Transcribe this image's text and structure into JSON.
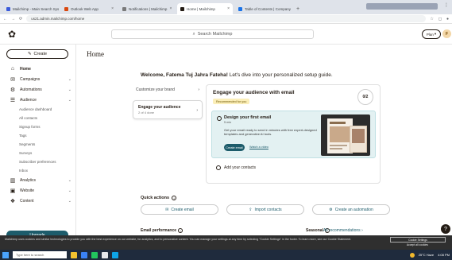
{
  "browser": {
    "tabs": [
      {
        "label": "Mailchimp - Main Search Sys",
        "color": "#3b5bdb",
        "active": false
      },
      {
        "label": "Outlook Web App",
        "color": "#d9480f",
        "active": false
      },
      {
        "label": "Notifications | Mailchimp",
        "color": "#7a7a7a",
        "active": false
      },
      {
        "label": "Home | Mailchimp",
        "color": "#241c15",
        "active": true
      },
      {
        "label": "Table of Contents | Company",
        "color": "#1a73e8",
        "active": false
      }
    ],
    "url": "us21.admin.mailchimp.com/home",
    "new_tab": "+"
  },
  "header": {
    "search_placeholder": "Search Mailchimp",
    "plan_label": "Plan",
    "avatar_initial": "F"
  },
  "sidebar": {
    "create_label": "Create",
    "items": [
      {
        "icon": "home-icon",
        "glyph": "⌂",
        "label": "Home",
        "active": true,
        "chevron": false,
        "sub": false
      },
      {
        "icon": "campaigns-icon",
        "glyph": "✉",
        "label": "Campaigns",
        "active": false,
        "chevron": true,
        "sub": false
      },
      {
        "icon": "automations-icon",
        "glyph": "⚙",
        "label": "Automations",
        "active": false,
        "chevron": true,
        "sub": false
      },
      {
        "icon": "audience-icon",
        "glyph": "☰",
        "label": "Audience",
        "active": false,
        "chevron": true,
        "sub": false
      },
      {
        "label": "Audience dashboard",
        "sub": true
      },
      {
        "label": "All contacts",
        "sub": true
      },
      {
        "label": "Signup forms",
        "sub": true
      },
      {
        "label": "Tags",
        "sub": true
      },
      {
        "label": "Segments",
        "sub": true
      },
      {
        "label": "Surveys",
        "sub": true
      },
      {
        "label": "Subscriber preferences",
        "sub": true
      },
      {
        "label": "Inbox",
        "sub": true
      },
      {
        "icon": "analytics-icon",
        "glyph": "▥",
        "label": "Analytics",
        "active": false,
        "chevron": true,
        "sub": false
      },
      {
        "icon": "website-icon",
        "glyph": "▣",
        "label": "Website",
        "active": false,
        "chevron": true,
        "sub": false
      },
      {
        "icon": "content-icon",
        "glyph": "❖",
        "label": "Content",
        "active": false,
        "chevron": true,
        "sub": false
      }
    ],
    "upgrade_label": "Upgrade"
  },
  "main": {
    "page_title": "Home",
    "welcome_bold": "Welcome, Fatema Tuj Jahra Fateha!",
    "welcome_rest": " Let's dive into your personalized setup guide.",
    "steps": [
      {
        "label": "Customize your brand",
        "active": false
      },
      {
        "label": "Engage your audience",
        "sub": "2 of 4 done",
        "active": true
      }
    ],
    "task_panel": {
      "title": "Engage your audience with email",
      "chip": "Recommended for you",
      "progress": "0/2",
      "design_title": "Design your first email",
      "design_time": "5 min",
      "design_desc": "Get your email ready to send in minutes with free expert-designed templates and generative AI tools.",
      "create_email": "Create email",
      "watch": "Watch a video",
      "add_contacts": "Add your contacts"
    },
    "quick_actions_label": "Quick actions",
    "quick_actions": [
      {
        "icon": "email-icon",
        "glyph": "✉",
        "label": "Create email"
      },
      {
        "icon": "import-icon",
        "glyph": "⇪",
        "label": "Import contacts"
      },
      {
        "icon": "automation-icon",
        "glyph": "⚙",
        "label": "Create an automation"
      }
    ],
    "performance_label": "Email performance",
    "seasonal_label": "Seasonal",
    "all_recs": "All recommendations"
  },
  "cookie": {
    "text": "Mailchimp uses cookies and similar technologies to provide you with the best experience on our website, for analytics, and to personalize content. You can manage your settings at any time by selecting \"Cookie Settings\" in the footer. To learn more, see our Cookie Statement.",
    "settings_button": "Cookie Settings",
    "accept": "Accept all cookies"
  },
  "taskbar": {
    "search": "Type here to search",
    "tray_temp": "25°C Haze",
    "time": "4:08 PM"
  }
}
